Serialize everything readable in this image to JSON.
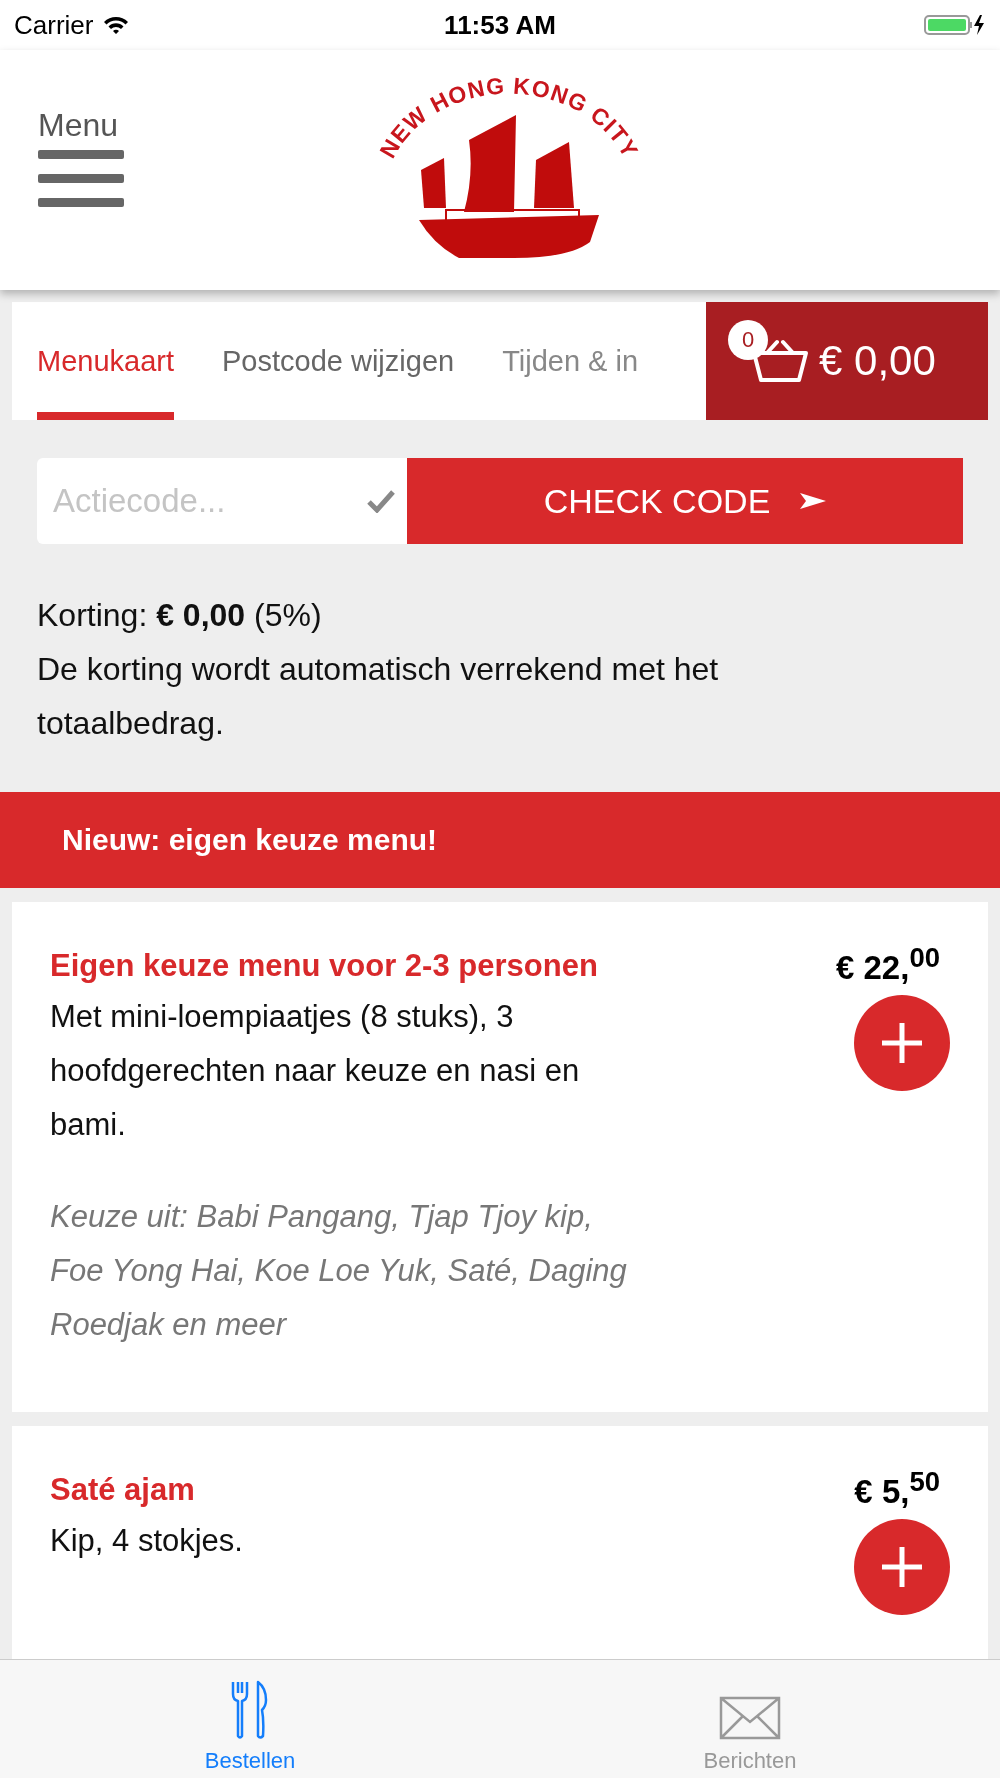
{
  "status_bar": {
    "carrier": "Carrier",
    "time": "11:53 AM"
  },
  "header": {
    "menu_label": "Menu",
    "logo_text": "NEW HONG KONG CITY"
  },
  "tabs": [
    {
      "label": "Menukaart",
      "selected": true
    },
    {
      "label": "Postcode wijzigen",
      "selected": false
    },
    {
      "label": "Tijden & in",
      "selected": false
    }
  ],
  "cart": {
    "count": "0",
    "total": "€ 0,00"
  },
  "promo": {
    "placeholder": "Actiecode...",
    "button": "CHECK CODE",
    "discount": "Korting: **€ 0,00** (5%)",
    "note": "De korting wordt automatisch verrekend met het totaalbedrag."
  },
  "section_title": "Nieuw: eigen keuze menu!",
  "items": [
    {
      "name": "Eigen keuze menu voor 2-3 personen",
      "price": "€ 22,$^{00}$",
      "description": "Met mini-loempiaatjes (8 stuks), 3 hoofdgerechten naar keuze en nasi en bami.",
      "choices": "Keuze uit: Babi Pangang, Tjap Tjoy kip, Foe Yong Hai, Koe Loe Yuk, Saté, Daging Roedjak en meer"
    },
    {
      "name": "Saté ajam",
      "price": "€ 5,$^{50}$",
      "description": "Kip, 4 stokjes."
    }
  ],
  "tab_bar": [
    {
      "label": "Bestellen",
      "kind": "order",
      "selected": true
    },
    {
      "label": "Berichten",
      "kind": "messages",
      "selected": false
    }
  ]
}
